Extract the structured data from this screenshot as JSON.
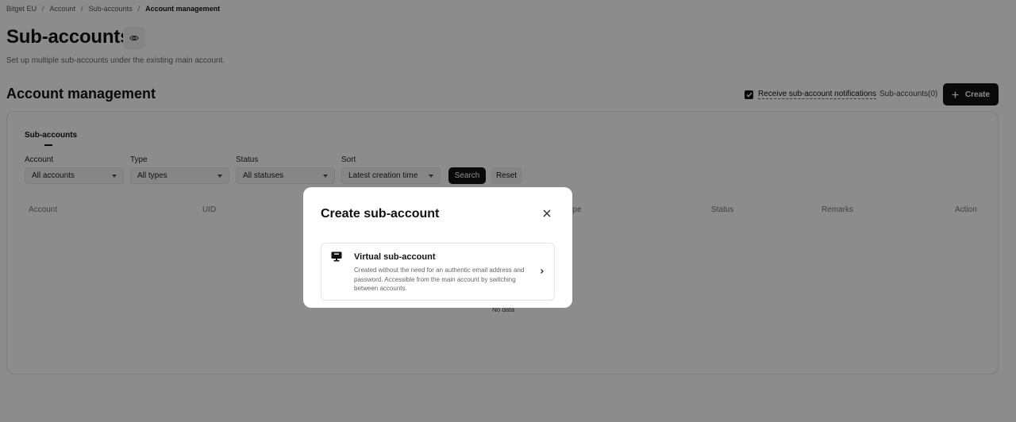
{
  "breadcrumb": [
    "Bitget EU",
    "Account",
    "Sub-accounts",
    "Account management"
  ],
  "breadcrumb_separator": "/",
  "page": {
    "title": "Sub-accounts",
    "subtitle": "Set up multiple sub-accounts under the existing main account."
  },
  "section": {
    "title": "Account management",
    "notification_label": "Receive sub-account notifications",
    "notification_checked": true,
    "sub_accounts_count": "Sub-accounts(0)",
    "create_label": "Create"
  },
  "tabs": [
    {
      "label": "Sub-accounts",
      "active": true
    }
  ],
  "filters": [
    {
      "label": "Account",
      "value": "All accounts"
    },
    {
      "label": "Type",
      "value": "All types"
    },
    {
      "label": "Status",
      "value": "All statuses"
    },
    {
      "label": "Sort",
      "value": "Latest creation time"
    }
  ],
  "buttons": {
    "search": "Search",
    "reset": "Reset"
  },
  "table": {
    "columns": [
      "Account",
      "UID",
      "Type",
      "Status",
      "Remarks",
      "Action"
    ],
    "empty_text": "No data"
  },
  "modal": {
    "title": "Create sub-account",
    "options": [
      {
        "title": "Virtual sub-account",
        "description": "Created without the need for an authentic email address and password. Accessible from the main account by switching between accounts.",
        "icon": "monitor-icon"
      }
    ]
  },
  "colors": {
    "primary": "#111111",
    "overlay": "rgba(0,0,0,0.45)",
    "muted_text": "#666666"
  }
}
